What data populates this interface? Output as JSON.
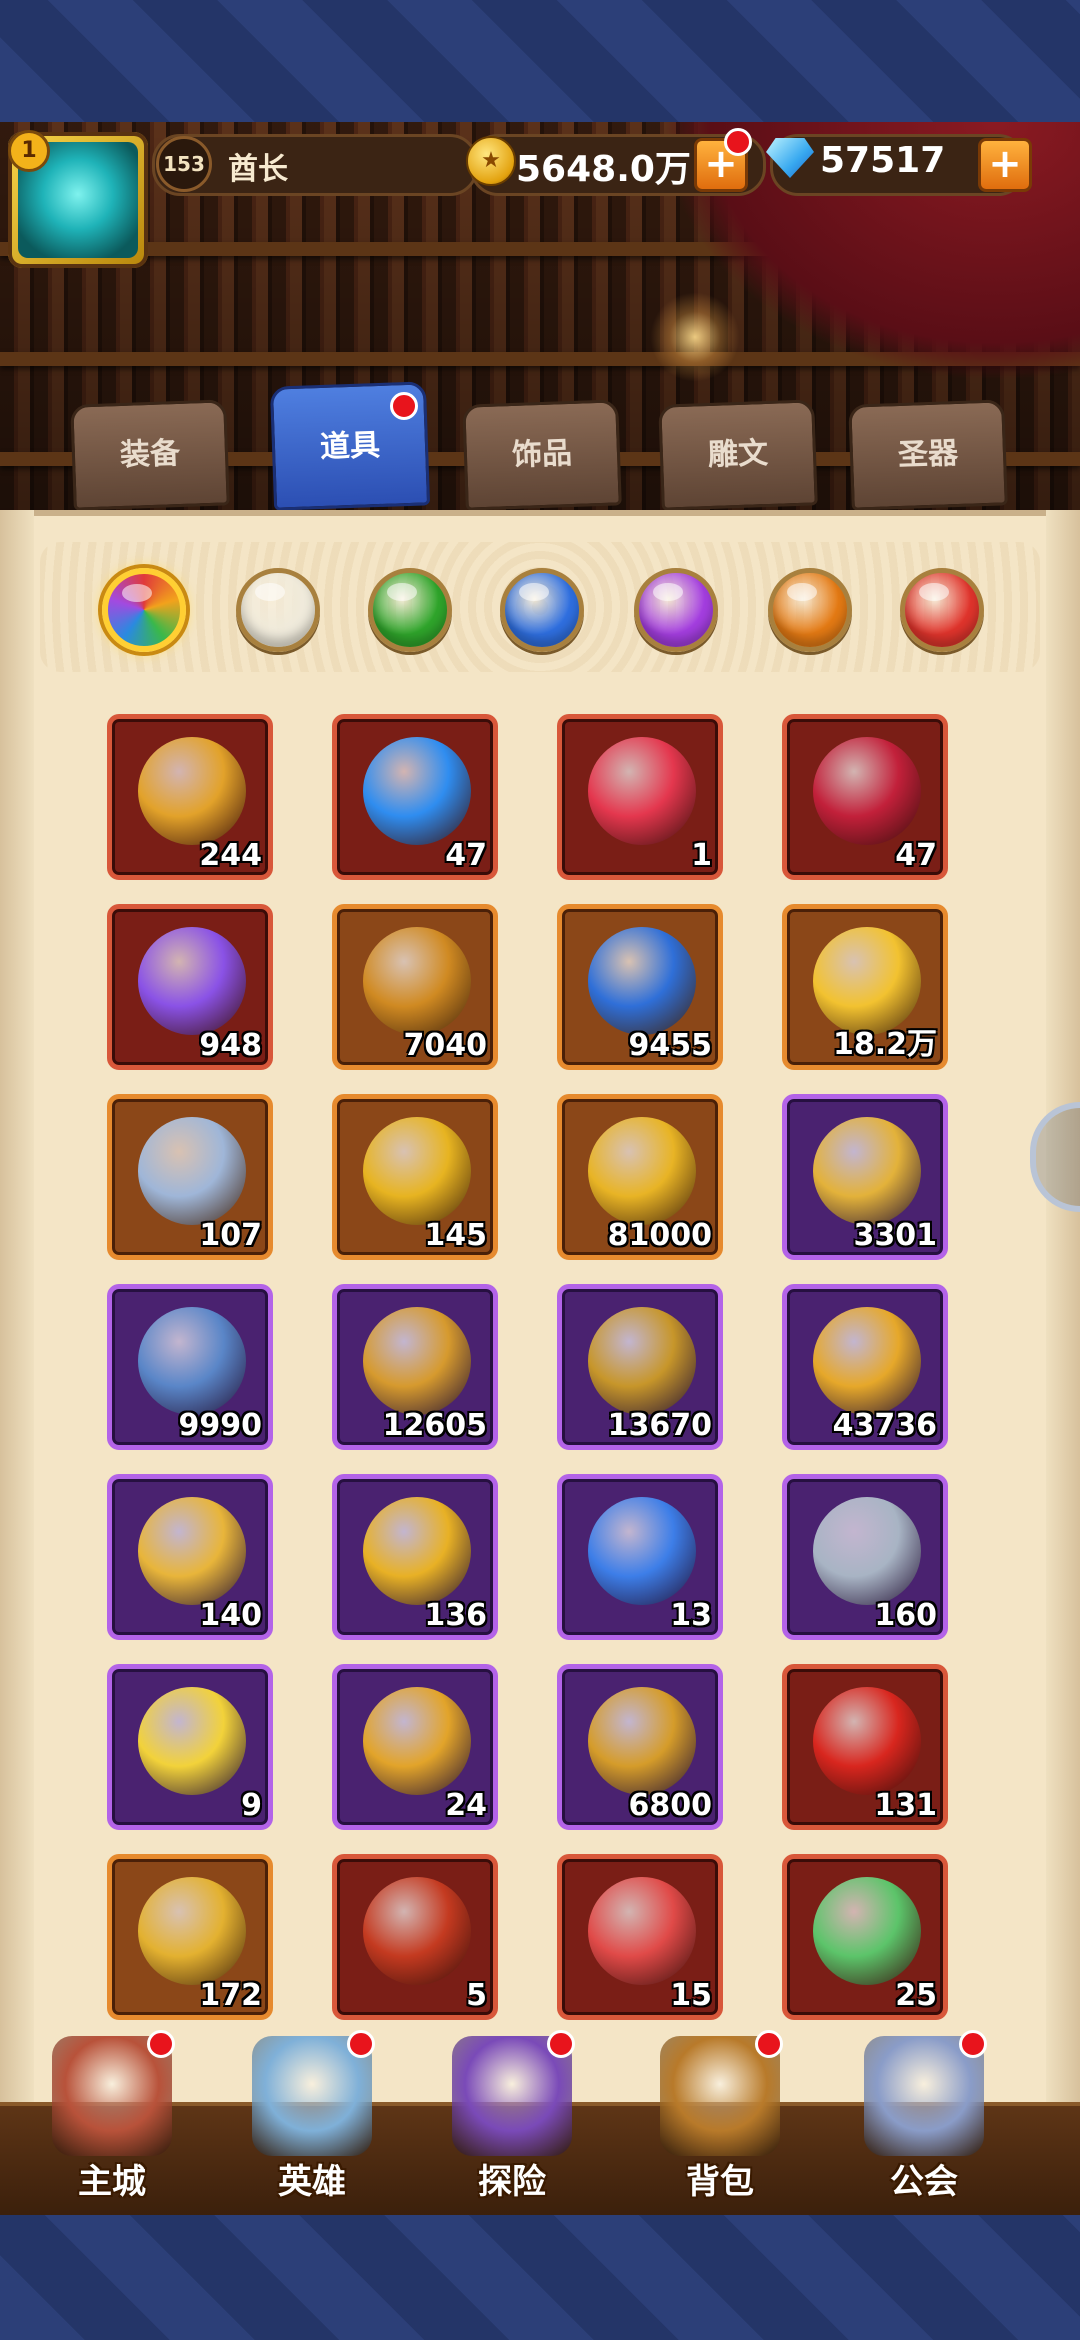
{
  "player": {
    "level": "153",
    "name": "酋长",
    "badge": "1"
  },
  "currency": {
    "gold": "5648.0万",
    "gems": "57517"
  },
  "tabs": [
    {
      "label": "装备",
      "active": false
    },
    {
      "label": "道具",
      "active": true
    },
    {
      "label": "饰品",
      "active": false
    },
    {
      "label": "雕文",
      "active": false
    },
    {
      "label": "圣器",
      "active": false
    }
  ],
  "filters": [
    {
      "name": "all",
      "color": "rainbow",
      "selected": true
    },
    {
      "name": "white",
      "color": "#efeadb"
    },
    {
      "name": "green",
      "color": "#2fa52b"
    },
    {
      "name": "blue",
      "color": "#2f6fe0"
    },
    {
      "name": "purple",
      "color": "#a43ee0"
    },
    {
      "name": "orange",
      "color": "#e47a14"
    },
    {
      "name": "red",
      "color": "#e0342c"
    }
  ],
  "items": [
    {
      "icon": "eagle-coin-icon",
      "count": "244",
      "rarity": "red",
      "color": "#e2a22a"
    },
    {
      "icon": "blue-egg-icon",
      "count": "47",
      "rarity": "red",
      "color": "#2f8df0"
    },
    {
      "icon": "red-crystal-icon",
      "count": "1",
      "rarity": "red",
      "color": "#e4374e"
    },
    {
      "icon": "red-crystal-cluster-icon",
      "count": "47",
      "rarity": "red",
      "color": "#c2203a"
    },
    {
      "icon": "potion-bottle-icon",
      "count": "948",
      "rarity": "red",
      "color": "#8a52e6"
    },
    {
      "icon": "skull-coin-icon",
      "count": "7040",
      "rarity": "orange",
      "color": "#d08a22"
    },
    {
      "icon": "blue-gem-key-icon",
      "count": "9455",
      "rarity": "orange",
      "color": "#2f6fd8"
    },
    {
      "icon": "smiley-coin-icon",
      "count": "18.2万",
      "rarity": "orange",
      "color": "#f2c230"
    },
    {
      "icon": "star-badge-icon",
      "count": "107",
      "rarity": "orange",
      "color": "#9fb6d8"
    },
    {
      "icon": "magnifier-coin-icon",
      "count": "145",
      "rarity": "orange",
      "color": "#e7b421"
    },
    {
      "icon": "gold-coin-icon",
      "count": "81000",
      "rarity": "orange",
      "color": "#e8b425"
    },
    {
      "icon": "diamond-sun-badge-icon",
      "count": "3301",
      "rarity": "purple",
      "color": "#e3b23a"
    },
    {
      "icon": "rune-stone-icon",
      "count": "9990",
      "rarity": "purple",
      "color": "#5a86c8"
    },
    {
      "icon": "winged-heart-icon",
      "count": "12605",
      "rarity": "purple",
      "color": "#d69a2e"
    },
    {
      "icon": "purple-gem-shield-icon",
      "count": "13670",
      "rarity": "purple",
      "color": "#c7962a"
    },
    {
      "icon": "gold-shield-icon",
      "count": "43736",
      "rarity": "purple",
      "color": "#e6a82a"
    },
    {
      "icon": "puzzle-piece-icon",
      "count": "140",
      "rarity": "purple",
      "color": "#e8b53a"
    },
    {
      "icon": "m-coin-icon",
      "count": "136",
      "rarity": "purple",
      "color": "#e8b125"
    },
    {
      "icon": "blue-crystal-icon",
      "count": "13",
      "rarity": "purple",
      "color": "#3d7ee8"
    },
    {
      "icon": "silver-magnifier-icon",
      "count": "160",
      "rarity": "purple",
      "color": "#a8b4c4"
    },
    {
      "icon": "yellow-crystal-icon",
      "count": "9",
      "rarity": "purple",
      "color": "#f2d23a"
    },
    {
      "icon": "hexagon-coin-icon",
      "count": "24",
      "rarity": "purple",
      "color": "#e2a42a"
    },
    {
      "icon": "gold-helmet-icon",
      "count": "6800",
      "rarity": "purple",
      "color": "#d59c2a"
    },
    {
      "icon": "red-lips-icon",
      "count": "131",
      "rarity": "red",
      "color": "#d8261e"
    },
    {
      "icon": "gold-ingot-icon",
      "count": "172",
      "rarity": "orange",
      "color": "#e3b130"
    },
    {
      "icon": "red-card-icon",
      "count": "5",
      "rarity": "red",
      "color": "#c43a20"
    },
    {
      "icon": "red-bottle-icon",
      "count": "15",
      "rarity": "red",
      "color": "#e04a48"
    },
    {
      "icon": "green-pills-icon",
      "count": "25",
      "rarity": "red",
      "color": "#5cc46a"
    }
  ],
  "nav": [
    {
      "label": "主城",
      "icon": "castle-icon",
      "color": "#b8523a"
    },
    {
      "label": "英雄",
      "icon": "hero-icon",
      "color": "#7fb0d8"
    },
    {
      "label": "探险",
      "icon": "portal-icon",
      "color": "#7a4ab8"
    },
    {
      "label": "背包",
      "icon": "backpack-icon",
      "color": "#b87a2a"
    },
    {
      "label": "公会",
      "icon": "guild-tower-icon",
      "color": "#8a9cc8"
    }
  ]
}
